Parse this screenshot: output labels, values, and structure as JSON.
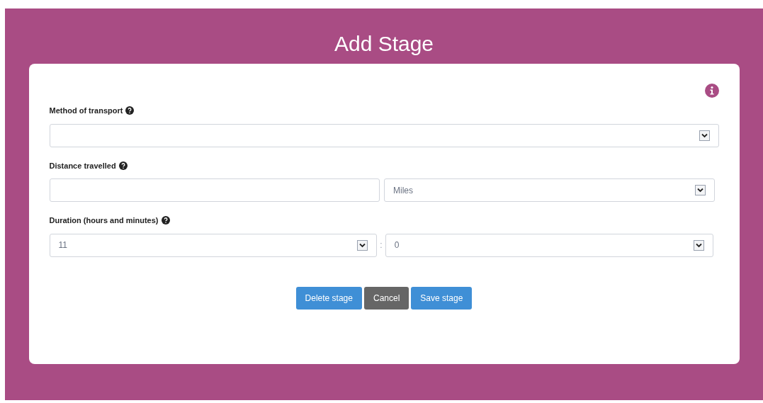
{
  "title": "Add Stage",
  "fields": [
    {
      "kind": "select",
      "label": "Method of transport"
    },
    {
      "kind": "distance",
      "label": "Distance travelled",
      "unit": "Miles"
    },
    {
      "kind": "duration",
      "label": "Duration (hours and minutes)",
      "hours": "11",
      "separator": ":",
      "minutes": "0"
    }
  ],
  "buttons": [
    {
      "label": "Delete stage",
      "kind": "primary"
    },
    {
      "label": "Cancel",
      "kind": "secondary"
    },
    {
      "label": "Save stage",
      "kind": "primary"
    }
  ]
}
